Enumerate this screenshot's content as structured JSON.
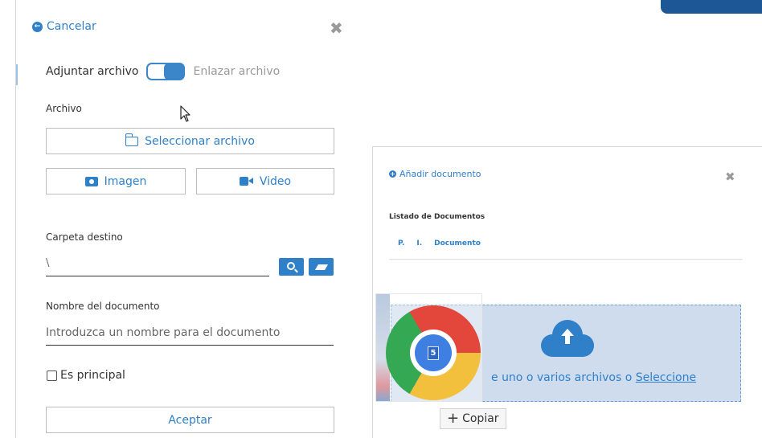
{
  "left_panel": {
    "cancel_label": "Cancelar",
    "close_glyph": "✖",
    "mode": {
      "attach_label": "Adjuntar archivo",
      "link_label": "Enlazar archivo"
    },
    "file_section_label": "Archivo",
    "select_file_label": "Seleccionar archivo",
    "image_label": "Imagen",
    "video_label": "Video",
    "folder_label": "Carpeta destino",
    "folder_value": "\\",
    "doc_name_label": "Nombre del documento",
    "doc_name_placeholder": "Introduzca un nombre para el documento",
    "principal_label": "Es principal",
    "accept_label": "Aceptar"
  },
  "right_panel": {
    "add_document_label": "Añadir documento",
    "close_glyph": "✖",
    "list_title": "Listado de Documentos",
    "columns": [
      "P.",
      "I.",
      "Documento"
    ],
    "dropzone": {
      "text_partial": "e uno o varios archivos o ",
      "link_text": "Seleccione"
    }
  },
  "drag_overlay": {
    "badge": "5",
    "copy_label": "Copiar",
    "copy_glyph": "+"
  },
  "colors": {
    "accent": "#2f80c9",
    "dropzone_bg": "#cfdcee",
    "corner_tab": "#1d5796"
  }
}
